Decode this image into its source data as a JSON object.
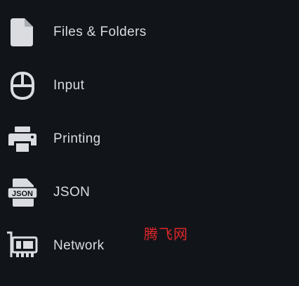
{
  "menu": {
    "items": [
      {
        "label": "Files & Folders",
        "icon": "file-icon"
      },
      {
        "label": "Input",
        "icon": "mouse-icon"
      },
      {
        "label": "Printing",
        "icon": "printer-icon"
      },
      {
        "label": "JSON",
        "icon": "json-file-icon",
        "icon_text": "JSON"
      },
      {
        "label": "Network",
        "icon": "network-card-icon"
      }
    ]
  },
  "watermark": {
    "text": "腾飞网"
  },
  "colors": {
    "background": "#111519",
    "text": "#dadce0",
    "icon": "#dadce0",
    "watermark": "#e0262a"
  }
}
